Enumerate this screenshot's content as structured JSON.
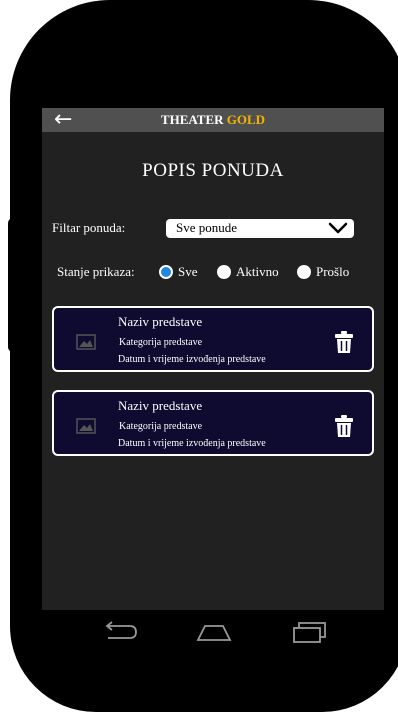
{
  "colors": {
    "topbar": "#505050",
    "screen": "#212121",
    "accent_gold": "#f4b400",
    "card_bg": "#0f0a30",
    "radio_selected": "#1e88e5"
  },
  "app": {
    "back_icon": "arrow-left-icon",
    "brand_part1": "THEATER",
    "brand_part2": "GOLD"
  },
  "page": {
    "title": "POPIS PONUDA"
  },
  "filter": {
    "label": "Filtar ponuda:",
    "selected": "Sve ponude",
    "icon": "chevron-down-icon"
  },
  "display_state": {
    "label": "Stanje prikaza:",
    "options": [
      {
        "label": "Sve",
        "selected": true
      },
      {
        "label": "Aktivno",
        "selected": false
      },
      {
        "label": "Prošlo",
        "selected": false
      }
    ]
  },
  "offers": [
    {
      "name": "Naziv predstave",
      "category": "Kategorija predstave",
      "datetime": "Datum i vrijeme izvođenja predstave",
      "image_icon": "image-placeholder-icon",
      "delete_icon": "trash-icon"
    },
    {
      "name": "Naziv predstave",
      "category": "Kategorija predstave",
      "datetime": "Datum i vrijeme izvođenja predstave",
      "image_icon": "image-placeholder-icon",
      "delete_icon": "trash-icon"
    }
  ],
  "system_nav": {
    "back": "back-icon",
    "home": "home-icon",
    "recents": "recents-icon"
  }
}
